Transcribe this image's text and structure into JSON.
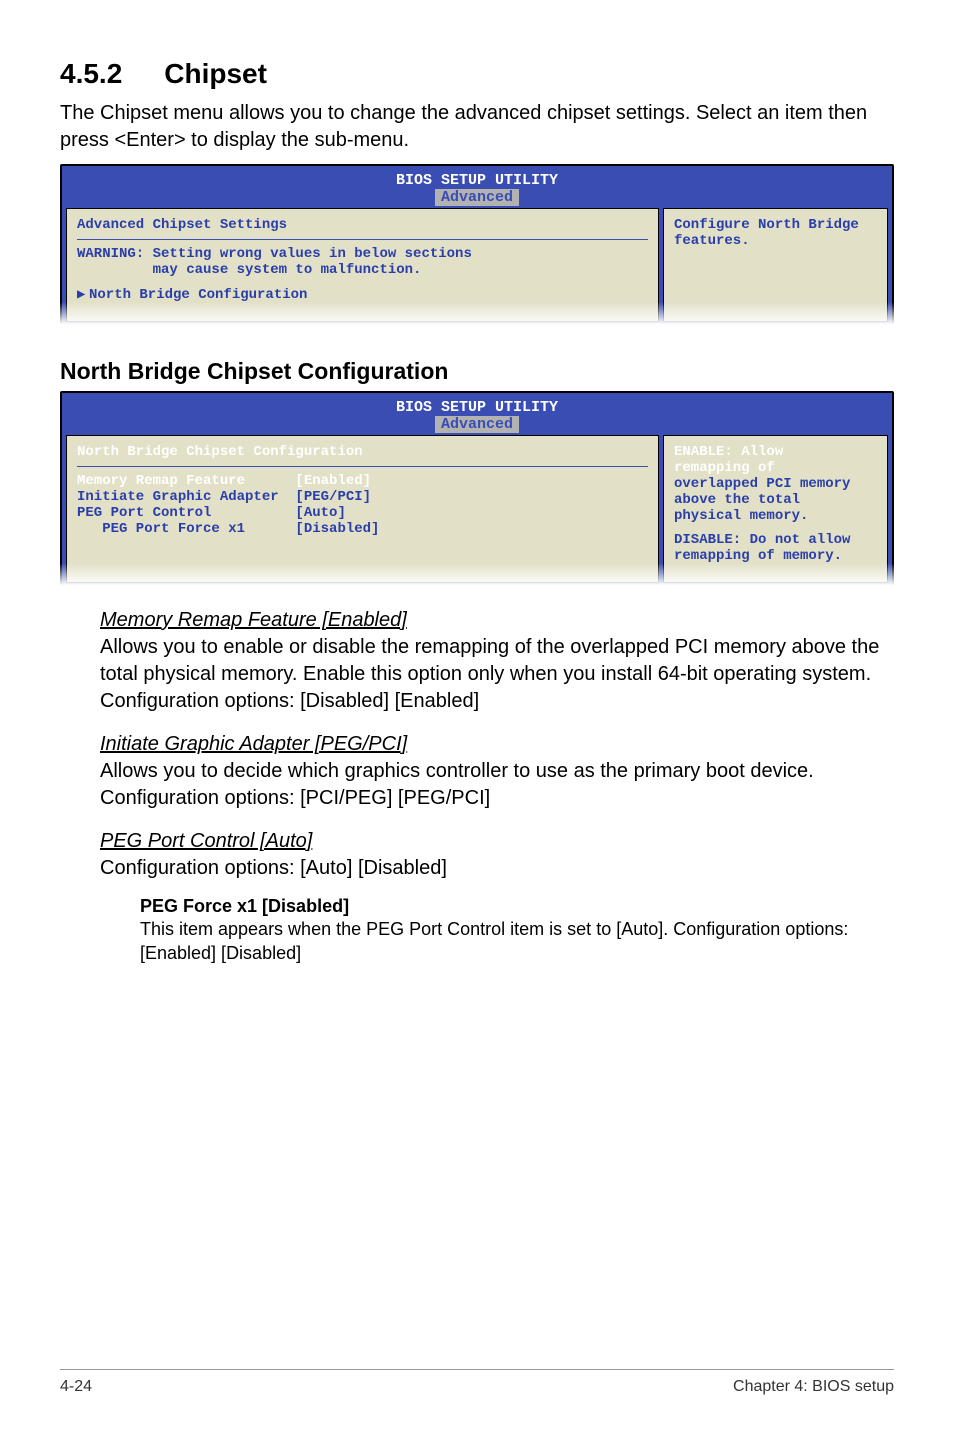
{
  "heading1_num": "4.5.2",
  "heading1_text": "Chipset",
  "intro": "The Chipset menu allows you to change the advanced chipset settings. Select an item then press <Enter> to display the sub-menu.",
  "bios1": {
    "title": "BIOS SETUP UTILITY",
    "tab": "Advanced",
    "main_heading": "Advanced Chipset Settings",
    "warning_l1": "WARNING: Setting wrong values in below sections",
    "warning_l2": "         may cause system to malfunction.",
    "item": "North Bridge Configuration",
    "side": "Configure North Bridge features."
  },
  "heading2": "North Bridge Chipset Configuration",
  "bios2": {
    "title": "BIOS SETUP UTILITY",
    "tab": "Advanced",
    "main_heading": "North Bridge Chipset Configuration",
    "rows": {
      "r1": "Memory Remap Feature      [Enabled]",
      "r2": "Initiate Graphic Adapter  [PEG/PCI]",
      "r3": "PEG Port Control          [Auto]",
      "r4": "   PEG Port Force x1      [Disabled]"
    },
    "side_l1": "ENABLE: Allow",
    "side_l2": "remapping of",
    "side_l3": "overlapped PCI memory",
    "side_l4": "above the total",
    "side_l5": "physical memory.",
    "side_l6": "DISABLE: Do not allow",
    "side_l7": "remapping of memory."
  },
  "sec_mem_head": "Memory Remap Feature [Enabled]",
  "sec_mem_body": "Allows you to enable or disable the remapping of the overlapped PCI memory above the total physical memory. Enable this option only when you install 64-bit operating system. Configuration options: [Disabled] [Enabled]",
  "sec_iga_head": "Initiate Graphic Adapter [PEG/PCI]",
  "sec_iga_body": "Allows you to decide which graphics controller to use as the primary boot device. Configuration options: [PCI/PEG] [PEG/PCI]",
  "sec_peg_head": "PEG Port Control [Auto]",
  "sec_peg_body": "Configuration options: [Auto] [Disabled]",
  "sub_head": "PEG Force x1 [Disabled]",
  "sub_body": "This item appears when the PEG Port Control item is set to [Auto]. Configuration options: [Enabled] [Disabled]",
  "footer_left": "4-24",
  "footer_right": "Chapter 4: BIOS setup"
}
